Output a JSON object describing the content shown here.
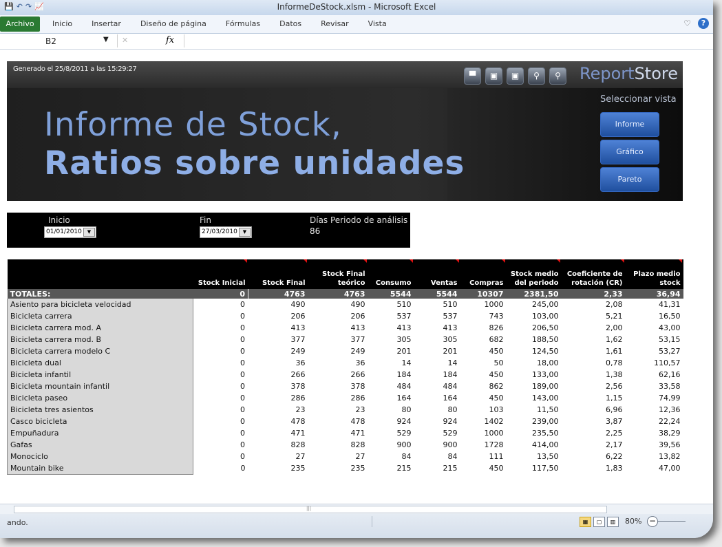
{
  "window": {
    "title": "InformeDeStock.xlsm - Microsoft Excel"
  },
  "ribbon": {
    "file_tab": "Archivo",
    "tabs": [
      "Inicio",
      "Insertar",
      "Diseño de página",
      "Fórmulas",
      "Datos",
      "Revisar",
      "Vista"
    ]
  },
  "formula_bar": {
    "name_box": "B2",
    "fx_label": "fx",
    "formula": ""
  },
  "banner": {
    "generated": "Generado el 25/8/2011 a las 15:29:27",
    "brand_a": "Report",
    "brand_b": "Store",
    "title_line1": "Informe de Stock,",
    "title_line2": "Ratios sobre unidades",
    "view_label": "Seleccionar vista",
    "view_buttons": [
      "Informe",
      "Gráfico",
      "Pareto"
    ]
  },
  "period": {
    "start_label": "Inicio",
    "start_value": "01/01/2010",
    "end_label": "Fin",
    "end_value": "27/03/2010",
    "days_label": "Días Periodo de análisis",
    "days_value": "86"
  },
  "table": {
    "headers": [
      "",
      "Stock Inicial",
      "Stock Final",
      "Stock Final teórico",
      "Consumo",
      "Ventas",
      "Compras",
      "Stock medio del periodo",
      "Coeficiente de rotación (CR)",
      "Plazo medio stock"
    ],
    "totals": [
      "TOTALES:",
      "0",
      "4763",
      "4763",
      "5544",
      "5544",
      "10307",
      "2381,50",
      "2,33",
      "36,94"
    ],
    "rows": [
      [
        "Asiento para bicicleta velocidad",
        "0",
        "490",
        "490",
        "510",
        "510",
        "1000",
        "245,00",
        "2,08",
        "41,31"
      ],
      [
        "Bicicleta carrera",
        "0",
        "206",
        "206",
        "537",
        "537",
        "743",
        "103,00",
        "5,21",
        "16,50"
      ],
      [
        "Bicicleta carrera mod. A",
        "0",
        "413",
        "413",
        "413",
        "413",
        "826",
        "206,50",
        "2,00",
        "43,00"
      ],
      [
        "Bicicleta carrera mod. B",
        "0",
        "377",
        "377",
        "305",
        "305",
        "682",
        "188,50",
        "1,62",
        "53,15"
      ],
      [
        "Bicicleta carrera modelo C",
        "0",
        "249",
        "249",
        "201",
        "201",
        "450",
        "124,50",
        "1,61",
        "53,27"
      ],
      [
        "Bicicleta dual",
        "0",
        "36",
        "36",
        "14",
        "14",
        "50",
        "18,00",
        "0,78",
        "110,57"
      ],
      [
        "Bicicleta infantil",
        "0",
        "266",
        "266",
        "184",
        "184",
        "450",
        "133,00",
        "1,38",
        "62,16"
      ],
      [
        "Bicicleta mountain infantil",
        "0",
        "378",
        "378",
        "484",
        "484",
        "862",
        "189,00",
        "2,56",
        "33,58"
      ],
      [
        "Bicicleta paseo",
        "0",
        "286",
        "286",
        "164",
        "164",
        "450",
        "143,00",
        "1,15",
        "74,99"
      ],
      [
        "Bicicleta tres asientos",
        "0",
        "23",
        "23",
        "80",
        "80",
        "103",
        "11,50",
        "6,96",
        "12,36"
      ],
      [
        "Casco bicicleta",
        "0",
        "478",
        "478",
        "924",
        "924",
        "1402",
        "239,00",
        "3,87",
        "22,24"
      ],
      [
        "Empuñadura",
        "0",
        "471",
        "471",
        "529",
        "529",
        "1000",
        "235,50",
        "2,25",
        "38,29"
      ],
      [
        "Gafas",
        "0",
        "828",
        "828",
        "900",
        "900",
        "1728",
        "414,00",
        "2,17",
        "39,56"
      ],
      [
        "Monociclo",
        "0",
        "27",
        "27",
        "84",
        "84",
        "111",
        "13,50",
        "6,22",
        "13,82"
      ],
      [
        "Mountain bike",
        "0",
        "235",
        "235",
        "215",
        "215",
        "450",
        "117,50",
        "1,83",
        "47,00"
      ]
    ]
  },
  "status": {
    "text": "ando.",
    "zoom": "80%"
  },
  "colors": {
    "file_tab": "#2a7a32",
    "title_blue": "#7fa0d9",
    "button_blue": "#2f64b8",
    "comment_marker": "#dd1111"
  }
}
